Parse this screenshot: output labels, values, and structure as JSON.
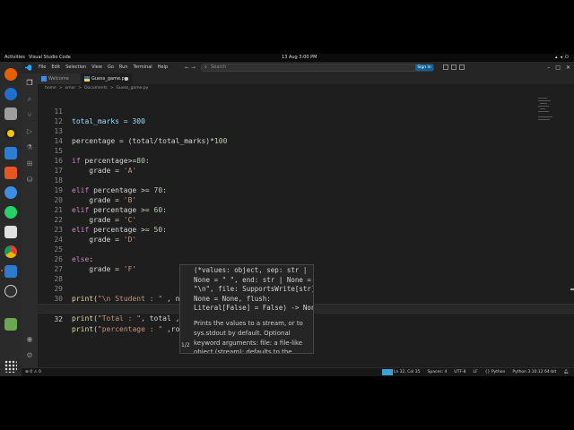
{
  "topbar": {
    "activities": "Activities",
    "app": "Visual Studio Code",
    "clock": "13 Aug  3:00 PM"
  },
  "window": {
    "menu": [
      "File",
      "Edit",
      "Selection",
      "View",
      "Go",
      "Run",
      "Terminal",
      "Help"
    ],
    "search_placeholder": "Search",
    "signin": "Sign in",
    "accent": "#0e639c"
  },
  "tabs": [
    {
      "label": "Welcome"
    },
    {
      "label": "Guess_game.py"
    }
  ],
  "breadcrumbs": [
    "home",
    ">",
    "omar",
    ">",
    "Documents",
    ">",
    "Guess_game.py"
  ],
  "editor": {
    "lines": [
      {
        "n": "11"
      },
      {
        "n": "12"
      },
      {
        "n": "13"
      },
      {
        "n": "14"
      },
      {
        "n": "15"
      },
      {
        "n": "16"
      },
      {
        "n": "17"
      },
      {
        "n": "18"
      },
      {
        "n": "19"
      },
      {
        "n": "20"
      },
      {
        "n": "21"
      },
      {
        "n": "22"
      },
      {
        "n": "23"
      },
      {
        "n": "24"
      },
      {
        "n": "25"
      },
      {
        "n": "26"
      },
      {
        "n": "27"
      },
      {
        "n": "28"
      },
      {
        "n": "29"
      },
      {
        "n": "30"
      },
      {
        "n": "31"
      },
      {
        "n": "32"
      }
    ],
    "code": {
      "l11": "total_marks = 300",
      "l13a": "percentage = (total/total_marks)*",
      "l13b": "100",
      "l15a": "if",
      "l15b": " percentage>=",
      "l15c": "80",
      "l15d": ":",
      "l16a": "    grade = ",
      "l16b": "'A'",
      "l18a": "elif",
      "l18b": " percentage >= ",
      "l18c": "70",
      "l18d": ":",
      "l19a": "    grade = ",
      "l19b": "'B'",
      "l20a": "elif",
      "l20b": " percentage >= ",
      "l20c": "60",
      "l20d": ":",
      "l21a": "    grade = ",
      "l21b": "'C'",
      "l22a": "elif",
      "l22b": " percentage >= ",
      "l22c": "50",
      "l22d": ":",
      "l23a": "    grade = ",
      "l23b": "'D'",
      "l25a": "else",
      "l25b": ":",
      "l26a": "    grade = ",
      "l26b": "'F'",
      "l29a": "print",
      "l29b": "(",
      "l29c": "\"\\n Student : \"",
      "l29d": " , n",
      "l31a": "print",
      "l31b": "(",
      "l31c": "\"Total : \"",
      "l31d": ", total ,",
      "l32a": "print",
      "l32b": "(",
      "l32c": "\"percentage : \"",
      "l32d": " ,ro",
      "l32e": ")"
    }
  },
  "hover": {
    "signature": "(*values: object, sep: str |\nNone = \" \", end: str | None =\n\"\\n\", file: SupportsWrite[str] |\nNone = None, flush:\nLiteral[False] = False) -> None",
    "doc": "Prints the values to a stream, or to sys.stdout by default. Optional keyword arguments: file: a file-like object (stream); defaults to the current sys.stdout. sep:",
    "pager": "1/2"
  },
  "status": {
    "left": "⊗ 0 ⚠ 0",
    "ln_col": "Ln 32, Col 35",
    "spaces": "Spaces: 4",
    "encoding": "UTF-8",
    "eol": "LF",
    "language": "{} Python",
    "interpreter": "Python 3.10.12 64-bit",
    "remote_color": "#3fa0d8"
  }
}
